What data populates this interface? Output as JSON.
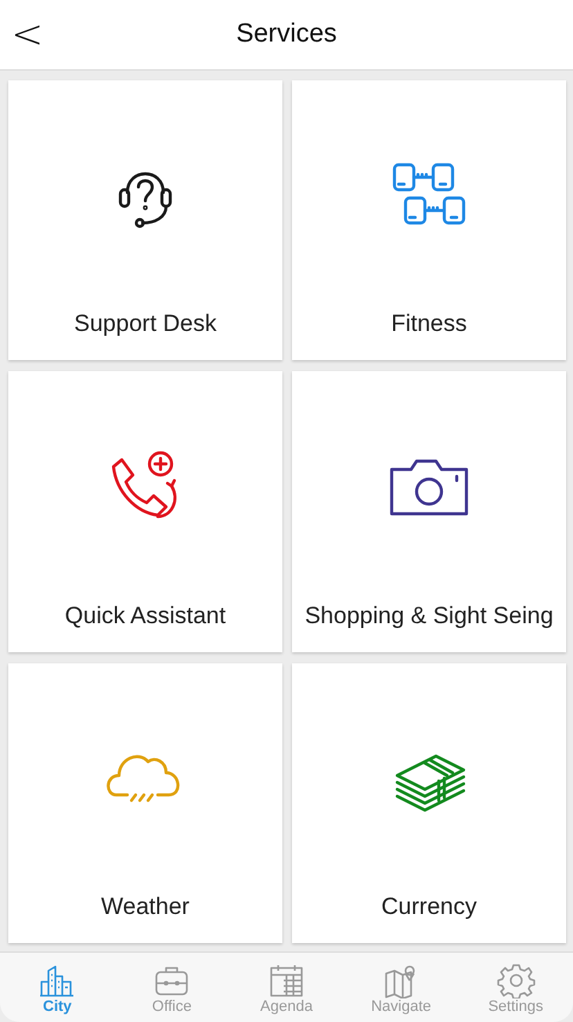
{
  "header": {
    "back": "<",
    "title": "Services"
  },
  "services": [
    {
      "label": "Support Desk",
      "kind": "headset",
      "color": "#1a1a1a"
    },
    {
      "label": "Fitness",
      "kind": "dumbbells",
      "color": "#1e88e5"
    },
    {
      "label": "Quick Assistant",
      "kind": "phone",
      "color": "#e0141e"
    },
    {
      "label": "Shopping & Sight Seing",
      "kind": "camera",
      "color": "#3f3590"
    },
    {
      "label": "Weather",
      "kind": "cloud",
      "color": "#e0a10f"
    },
    {
      "label": "Currency",
      "kind": "money",
      "color": "#138a1e"
    }
  ],
  "tabs": [
    {
      "label": "City",
      "kind": "city",
      "selected": true
    },
    {
      "label": "Office",
      "kind": "briefcase",
      "selected": false
    },
    {
      "label": "Agenda",
      "kind": "calendar",
      "selected": false
    },
    {
      "label": "Navigate",
      "kind": "map",
      "selected": false
    },
    {
      "label": "Settings",
      "kind": "gear",
      "selected": false
    }
  ]
}
